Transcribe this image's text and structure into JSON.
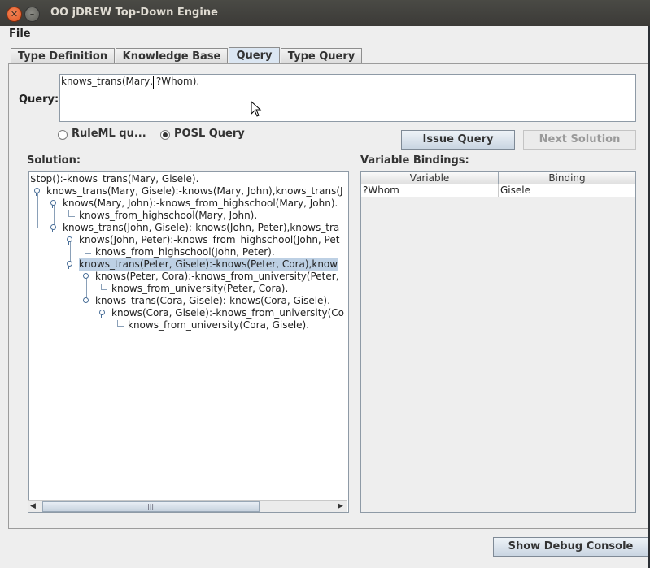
{
  "window": {
    "title": "OO jDREW Top-Down Engine"
  },
  "menu": {
    "file": "File"
  },
  "tabs": [
    {
      "label": "Type Definition"
    },
    {
      "label": "Knowledge Base"
    },
    {
      "label": "Query"
    },
    {
      "label": "Type Query"
    }
  ],
  "active_tab": "Query",
  "query": {
    "label": "Query:",
    "value": "knows_trans(Mary, ?Whom)."
  },
  "query_type": {
    "ruleml_label": "RuleML qu...",
    "posl_label": "POSL Query",
    "selected": "POSL Query"
  },
  "buttons": {
    "issue": "Issue Query",
    "next": "Next Solution",
    "debug": "Show Debug Console"
  },
  "solution": {
    "label": "Solution:",
    "nodes": [
      {
        "text": "$top():-knows_trans(Mary, Gisele)."
      },
      {
        "text": "knows_trans(Mary, Gisele):-knows(Mary, John),knows_trans(J"
      },
      {
        "text": "knows(Mary, John):-knows_from_highschool(Mary, John)."
      },
      {
        "text": "knows_from_highschool(Mary, John)."
      },
      {
        "text": "knows_trans(John, Gisele):-knows(John, Peter),knows_tra"
      },
      {
        "text": "knows(John, Peter):-knows_from_highschool(John, Pet"
      },
      {
        "text": "knows_from_highschool(John, Peter)."
      },
      {
        "text": "knows_trans(Peter, Gisele):-knows(Peter, Cora),know"
      },
      {
        "text": "knows(Peter, Cora):-knows_from_university(Peter,"
      },
      {
        "text": "knows_from_university(Peter, Cora)."
      },
      {
        "text": "knows_trans(Cora, Gisele):-knows(Cora, Gisele)."
      },
      {
        "text": "knows(Cora, Gisele):-knows_from_university(Co"
      },
      {
        "text": "knows_from_university(Cora, Gisele)."
      }
    ]
  },
  "bindings": {
    "label": "Variable Bindings:",
    "columns": [
      "Variable",
      "Binding"
    ],
    "rows": [
      {
        "variable": "?Whom",
        "binding": "Gisele"
      }
    ]
  },
  "colors": {
    "selection": "#bdd0e4",
    "button_accent": "#c9d5e2",
    "close_button": "#e0521f"
  }
}
